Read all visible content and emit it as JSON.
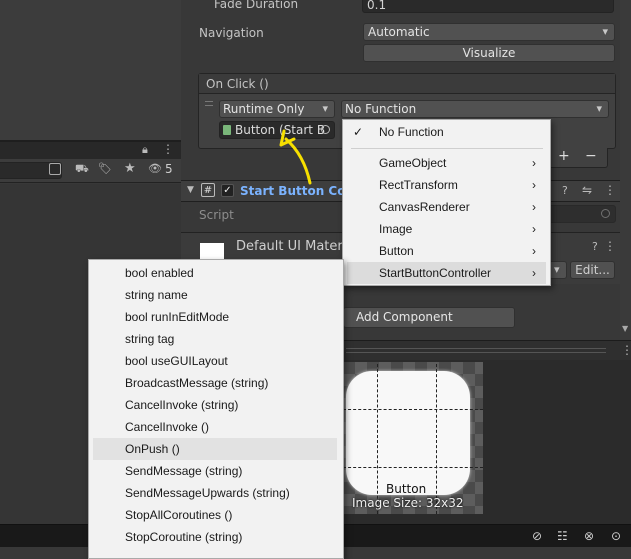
{
  "inspector": {
    "fade_duration_label": "Fade Duration",
    "fade_duration_value": "0.1",
    "navigation_label": "Navigation",
    "navigation_value": "Automatic",
    "visualize_label": "Visualize",
    "onclick_header": "On Click ()",
    "runtime_value": "Runtime Only",
    "function_value": "No Function",
    "object_field": "Button (Start B",
    "plus": "+",
    "minus": "−",
    "component_title": "Start Button Cont",
    "script_label": "Script",
    "material_name": "Default UI Materi",
    "edit_label": "Edit...",
    "add_component": "Add Component",
    "preview_caption": "Button",
    "image_size": "Image Size: 32x32"
  },
  "hierarchy": {
    "count_badge": "5"
  },
  "function_menu": {
    "checked_item": "No Function",
    "items": [
      "GameObject",
      "RectTransform",
      "CanvasRenderer",
      "Image",
      "Button",
      "StartButtonController"
    ],
    "highlighted": "StartButtonController"
  },
  "method_menu": {
    "items": [
      "bool enabled",
      "string name",
      "bool runInEditMode",
      "string tag",
      "bool useGUILayout",
      "BroadcastMessage (string)",
      "CancelInvoke (string)",
      "CancelInvoke ()",
      "OnPush ()",
      "SendMessage (string)",
      "SendMessageUpwards (string)",
      "StopAllCoroutines ()",
      "StopCoroutine (string)"
    ],
    "highlighted": "OnPush ()"
  },
  "colors": {
    "accent_blue": "#7bb3ff",
    "arrow_yellow": "#f7e000",
    "panel_dark": "#383838"
  }
}
